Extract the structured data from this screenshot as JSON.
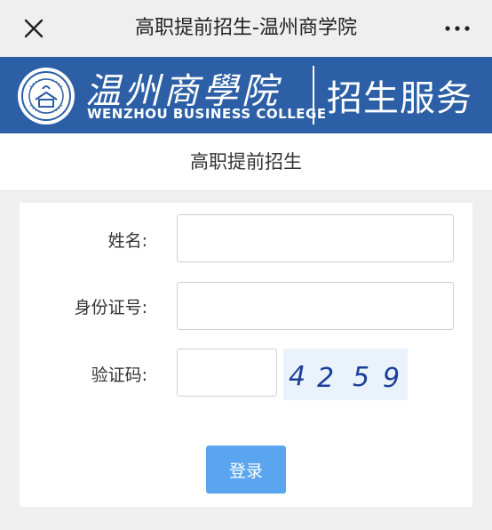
{
  "topbar": {
    "title": "高职提前招生-温州商学院"
  },
  "banner": {
    "cn_name": "温州商學院",
    "en_name": "WENZHOU BUSINESS COLLEGE",
    "service": "招生服务"
  },
  "subheader": {
    "title": "高职提前招生"
  },
  "form": {
    "name_label": "姓名:",
    "name_value": "",
    "id_label": "身份证号:",
    "id_value": "",
    "captcha_label": "验证码:",
    "captcha_value": "",
    "captcha_text": "4259",
    "login_label": "登录"
  },
  "colors": {
    "banner": "#2c5fa5",
    "button": "#5aa5ef",
    "captcha_ink": "#1b3f9a"
  }
}
